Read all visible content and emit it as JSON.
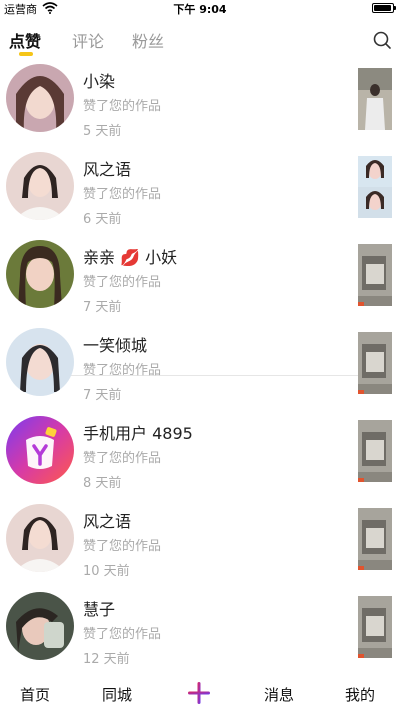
{
  "status_bar": {
    "carrier": "运营商",
    "time": "下午 9:04"
  },
  "tabs": [
    {
      "label": "点赞",
      "active": true
    },
    {
      "label": "评论",
      "active": false
    },
    {
      "label": "粉丝",
      "active": false
    }
  ],
  "accent_color": "#f5c518",
  "items": [
    {
      "name": "小染",
      "action": "赞了您的作品",
      "time": "5 天前"
    },
    {
      "name": "风之语",
      "action": "赞了您的作品",
      "time": "6 天前"
    },
    {
      "name": "亲亲 💋 小妖",
      "action": "赞了您的作品",
      "time": "7 天前"
    },
    {
      "name": "一笑倾城",
      "action": "赞了您的作品",
      "time": "7 天前"
    },
    {
      "name": "手机用户 4895",
      "action": "赞了您的作品",
      "time": "8 天前"
    },
    {
      "name": "风之语",
      "action": "赞了您的作品",
      "time": "10 天前"
    },
    {
      "name": "慧子",
      "action": "赞了您的作品",
      "time": "12 天前"
    }
  ],
  "bottom_nav": {
    "home": "首页",
    "local": "同城",
    "messages": "消息",
    "profile": "我的",
    "plus_icon": "plus-icon"
  }
}
